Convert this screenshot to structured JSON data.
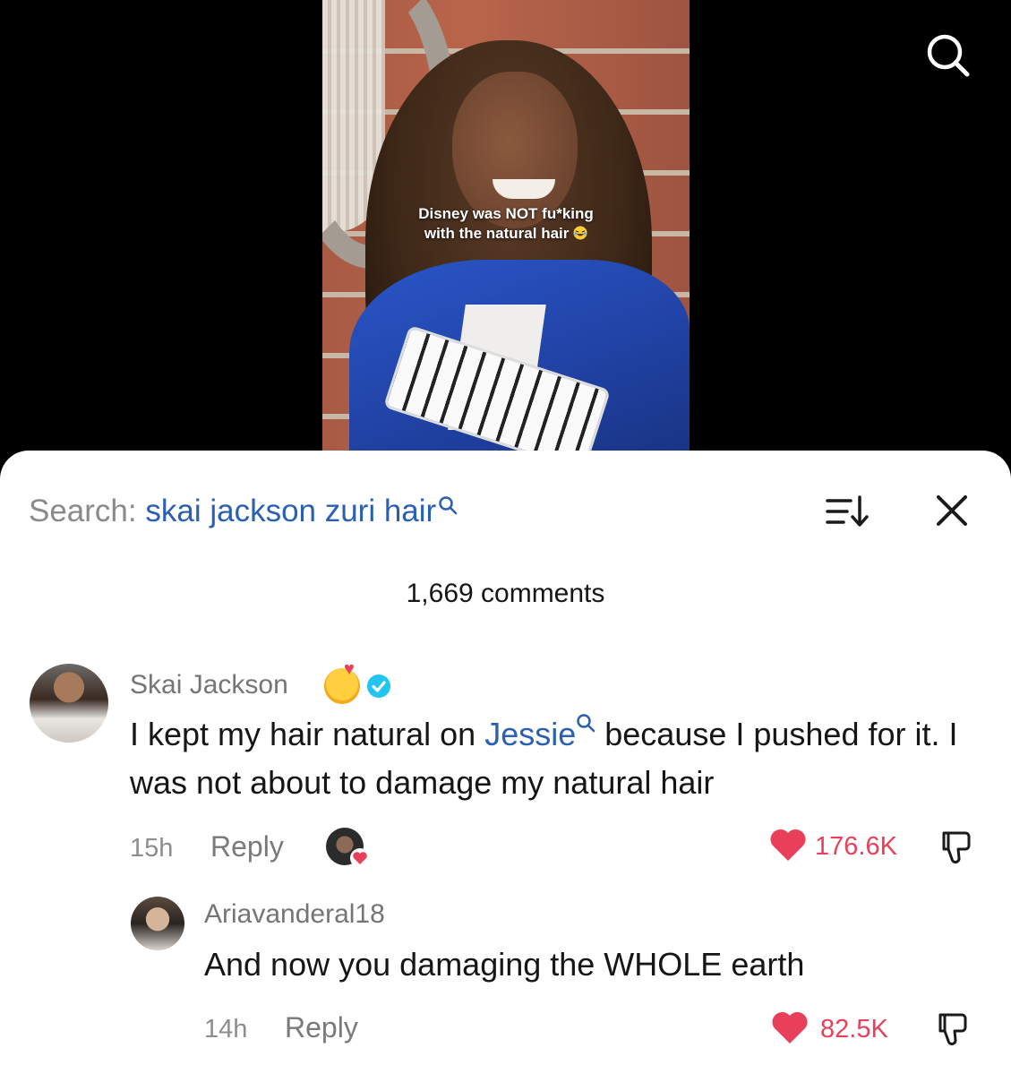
{
  "video": {
    "caption_line1": "Disney was NOT fu*king",
    "caption_line2": "with the natural hair",
    "caption_emoji": "laugh-cry-emoji"
  },
  "search": {
    "prefix": "Search:",
    "query": "skai jackson zuri hair"
  },
  "comments_header": {
    "count_label": "1,669 comments"
  },
  "comments": [
    {
      "username": "Skai Jackson",
      "verified": true,
      "emoji": "smiling-face-with-hearts",
      "text_before": "I kept my hair natural on ",
      "text_link": "Jessie",
      "text_after": " because I pushed for it. I was not about to damage my natural hair",
      "time": "15h",
      "reply_label": "Reply",
      "likes": "176.6K",
      "liked": true
    },
    {
      "username": "Ariavanderal18",
      "text": "And now you damaging the WHOLE earth",
      "time": "14h",
      "reply_label": "Reply",
      "likes": "82.5K",
      "liked": true
    }
  ],
  "colors": {
    "link": "#2b5fb3",
    "like": "#e8405a",
    "verified": "#20c5f0"
  }
}
